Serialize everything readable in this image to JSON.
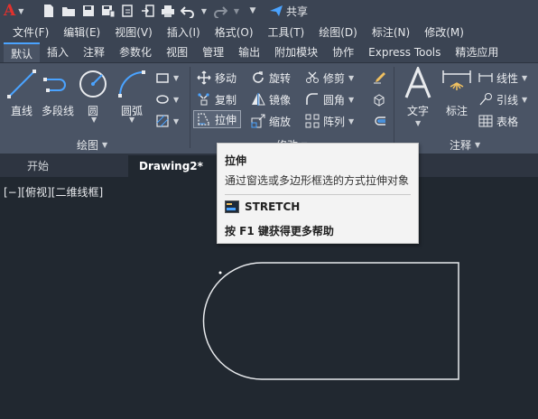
{
  "app": {
    "logo_text": "A",
    "share_label": "共享"
  },
  "menu": [
    "文件(F)",
    "编辑(E)",
    "视图(V)",
    "插入(I)",
    "格式(O)",
    "工具(T)",
    "绘图(D)",
    "标注(N)",
    "修改(M)"
  ],
  "ribbon_tabs": [
    "默认",
    "插入",
    "注释",
    "参数化",
    "视图",
    "管理",
    "输出",
    "附加模块",
    "协作",
    "Express Tools",
    "精选应用"
  ],
  "active_ribbon_tab": "默认",
  "draw_panel": {
    "title": "绘图",
    "line": "直线",
    "polyline": "多段线",
    "circle": "圆",
    "arc": "圆弧"
  },
  "modify_panel": {
    "title": "修改",
    "move": "移动",
    "rotate": "旋转",
    "trim": "修剪",
    "copy": "复制",
    "mirror": "镜像",
    "fillet": "圆角",
    "stretch": "拉伸",
    "scale": "缩放",
    "array": "阵列"
  },
  "annotation_panel": {
    "title": "注释",
    "text": "文字",
    "dimension": "标注",
    "linear": "线性",
    "leader": "引线",
    "table": "表格"
  },
  "doc_tabs": [
    "开始",
    "Drawing2*"
  ],
  "active_doc_tab": "Drawing2*",
  "viewport_label": "[−][俯视][二维线框]",
  "tooltip": {
    "title": "拉伸",
    "description": "通过窗选或多边形框选的方式拉伸对象",
    "command": "STRETCH",
    "help": "按 F1 键获得更多帮助"
  },
  "colors": {
    "background": "#212830",
    "ribbon": "#4a5465",
    "toolbar": "#3b4453",
    "accent": "#4aa3ff",
    "logo_red": "#e2312d"
  }
}
